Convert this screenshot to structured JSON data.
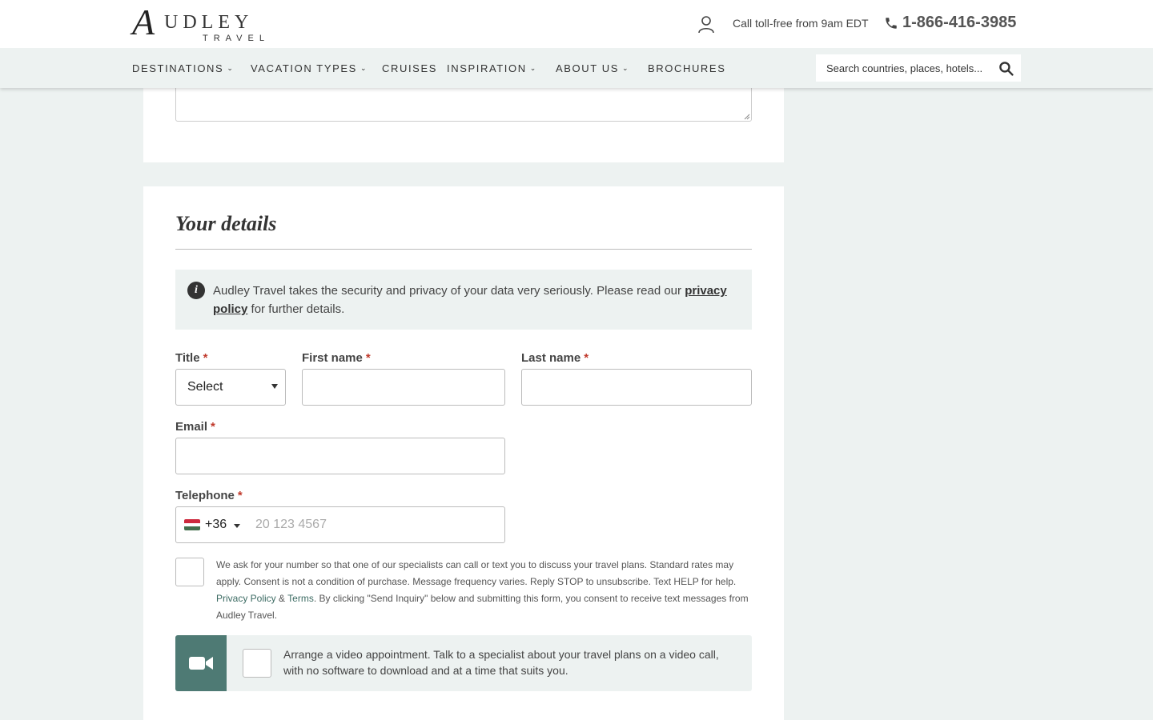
{
  "header": {
    "logo_initial": "A",
    "logo_rest": "UDLEY",
    "logo_sub": "TRAVEL",
    "call_text": "Call toll-free from 9am EDT",
    "phone_number": "1-866-416-3985"
  },
  "nav": {
    "items": [
      {
        "label": "DESTINATIONS",
        "dropdown": true
      },
      {
        "label": "VACATION TYPES",
        "dropdown": true
      },
      {
        "label": "CRUISES",
        "dropdown": false
      },
      {
        "label": "INSPIRATION",
        "dropdown": true
      },
      {
        "label": "ABOUT US",
        "dropdown": true
      },
      {
        "label": "BROCHURES",
        "dropdown": false
      }
    ],
    "search_placeholder": "Search countries, places, hotels..."
  },
  "form": {
    "section_title": "Your details",
    "info": {
      "text_before": "Audley Travel takes the security and privacy of your data very seriously. Please read our ",
      "link": "privacy policy",
      "text_after": " for further details."
    },
    "fields": {
      "title_label": "Title",
      "title_value": "Select",
      "first_name_label": "First name",
      "last_name_label": "Last name",
      "email_label": "Email",
      "telephone_label": "Telephone",
      "telephone_code": "+36",
      "telephone_placeholder": "20 123 4567",
      "required_mark": "*"
    },
    "consent": {
      "text_1": "We ask for your number so that one of our specialists can call or text you to discuss your travel plans. Standard rates may apply. Consent is not a condition of purchase. Message frequency varies. Reply STOP to unsubscribe. Text HELP for help. ",
      "link_privacy": "Privacy Policy",
      "amp": " & ",
      "link_terms": "Terms",
      "text_2": ". By clicking \"Send Inquiry\" below and submitting this form, you consent to receive text messages from Audley Travel."
    },
    "video": {
      "text": "Arrange a video appointment. Talk to a specialist about your travel plans on a video call, with no software to download and at a time that suits you."
    }
  },
  "colors": {
    "accent": "#4e7a74",
    "required": "#c0392b",
    "panel_bg": "#edf2f1"
  },
  "flag": [
    "#cd2a3e",
    "#ffffff",
    "#436f4d"
  ]
}
